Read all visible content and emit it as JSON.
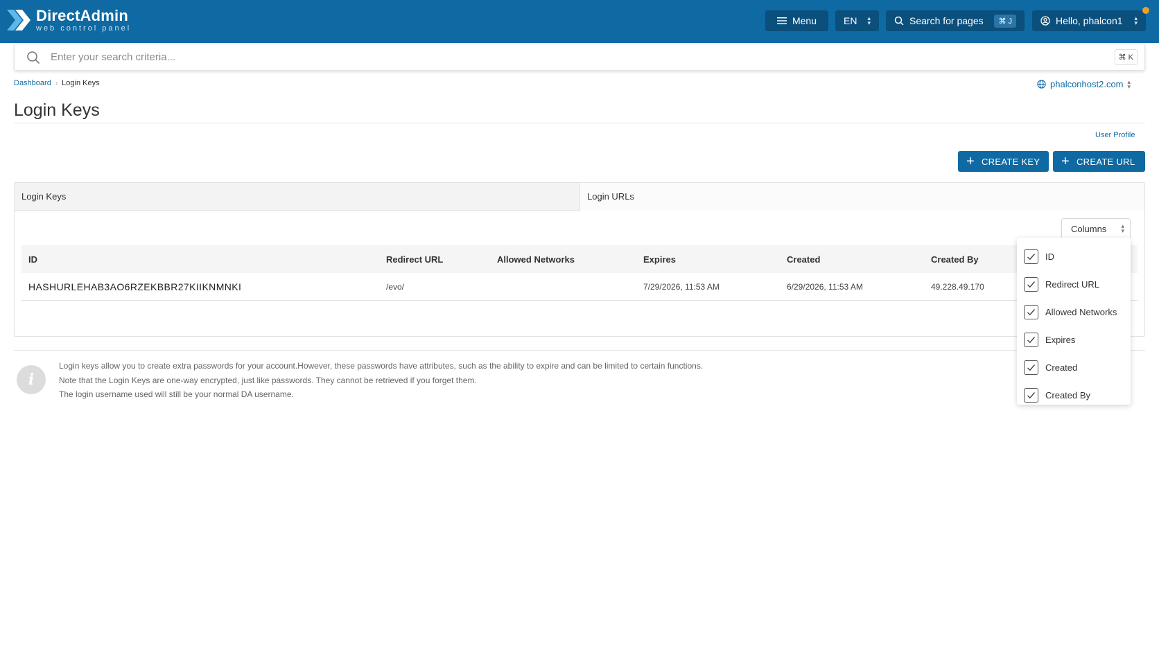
{
  "header": {
    "logo_title": "DirectAdmin",
    "logo_subtitle": "web control panel",
    "menu_label": "Menu",
    "language": "EN",
    "search_pages_label": "Search for pages",
    "search_pages_shortcut": "⌘ J",
    "user_greeting": "Hello, phalcon1",
    "accent_color": "#0f6aa3",
    "notification_color": "#f0a020"
  },
  "search": {
    "placeholder": "Enter your search criteria...",
    "shortcut": "⌘ K"
  },
  "breadcrumb": {
    "items": [
      "Dashboard",
      "Login Keys"
    ]
  },
  "domain_selector": "phalconhost2.com",
  "page": {
    "title": "Login Keys",
    "user_profile_link": "User Profile",
    "create_key_label": "CREATE KEY",
    "create_url_label": "CREATE URL"
  },
  "tabs": [
    {
      "label": "Login Keys",
      "active": true
    },
    {
      "label": "Login URLs",
      "active": false
    }
  ],
  "columns_button": "Columns",
  "table": {
    "headers": [
      "ID",
      "Redirect URL",
      "Allowed Networks",
      "Expires",
      "Created",
      "Created By"
    ],
    "rows": [
      [
        "HASHURLEHAB3AO6RZEKBBR27KIIKNMNKI",
        "/evo/",
        "",
        "7/29/2026, 11:53 AM",
        "6/29/2026, 11:53 AM",
        "49.228.49.170"
      ]
    ]
  },
  "columns_dropdown": [
    {
      "label": "ID",
      "checked": true
    },
    {
      "label": "Redirect URL",
      "checked": true
    },
    {
      "label": "Allowed Networks",
      "checked": true
    },
    {
      "label": "Expires",
      "checked": true
    },
    {
      "label": "Created",
      "checked": true
    },
    {
      "label": "Created By",
      "checked": true
    }
  ],
  "info": {
    "lines": [
      "Login keys allow you to create extra passwords for your account.However, these passwords have attributes, such as the ability to expire and can be limited to certain functions.",
      "Note that the Login Keys are one-way encrypted, just like passwords. They cannot be retrieved if you forget them.",
      "The login username used will still be your normal DA username."
    ]
  }
}
